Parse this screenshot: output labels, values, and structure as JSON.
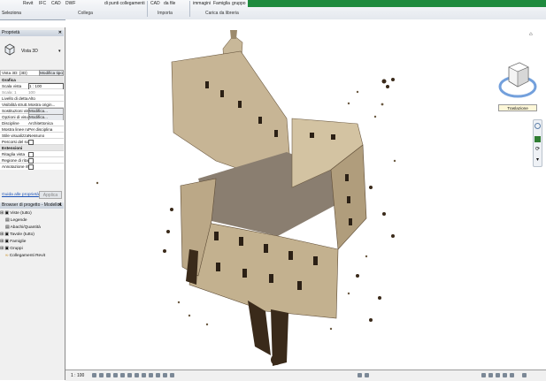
{
  "ribbon": {
    "buttons": [
      "Revit",
      "IFC",
      "CAD",
      "DWF",
      "di punti collegamenti",
      "CAD",
      "da file",
      "immagini",
      "Famiglia",
      "gruppo"
    ],
    "left_button": "Seleziona",
    "groups": [
      "Collega",
      "Importa",
      "Carica da libreria"
    ]
  },
  "properties": {
    "title": "Proprietà",
    "type_name": "Vista 3D",
    "selector": "Vista 3D: {3D}",
    "edit_type": "Modifica tipo",
    "section_graphics": "Grafica",
    "rows": [
      {
        "k": "Scala vista",
        "v": "1 : 100"
      },
      {
        "k": "Scala: 1",
        "v": "100"
      },
      {
        "k": "Livello di detta...",
        "v": "Alto"
      },
      {
        "k": "Visibilità strutt...",
        "v": "Mostra origin..."
      },
      {
        "k": "Sostituzioni visi...",
        "v": "Modifica..."
      },
      {
        "k": "Opzioni di visu...",
        "v": "Modifica..."
      },
      {
        "k": "Discipline",
        "v": "Architettonica"
      },
      {
        "k": "Mostra linee na...",
        "v": "Per disciplina"
      },
      {
        "k": "Stile visualizzaz...",
        "v": "Nessuno"
      },
      {
        "k": "Percorsi del sole",
        "v": ""
      }
    ],
    "section_extents": "Estensioni",
    "extent_rows": [
      {
        "k": "Ritaglia vista",
        "v": ""
      },
      {
        "k": "Regione di ritagl...",
        "v": ""
      },
      {
        "k": "Annotazione rita...",
        "v": ""
      }
    ],
    "help_link": "Guida alle proprietà",
    "apply": "Applica"
  },
  "browser": {
    "title": "Browser di progetto - Modello1",
    "items": [
      "Viste (tutto)",
      "Legende",
      "Abachi/Quantità",
      "Tavole (tutto)",
      "Famiglie",
      "Gruppi",
      "Collegamenti Revit"
    ]
  },
  "viewcube": {
    "label": "Traslazione",
    "color": "#5b8fd6"
  },
  "status": {
    "scale": "1 : 100"
  },
  "colors": {
    "green": "#1e8a3d",
    "stone": "#b7a586",
    "shadow": "#3a2a1a"
  }
}
